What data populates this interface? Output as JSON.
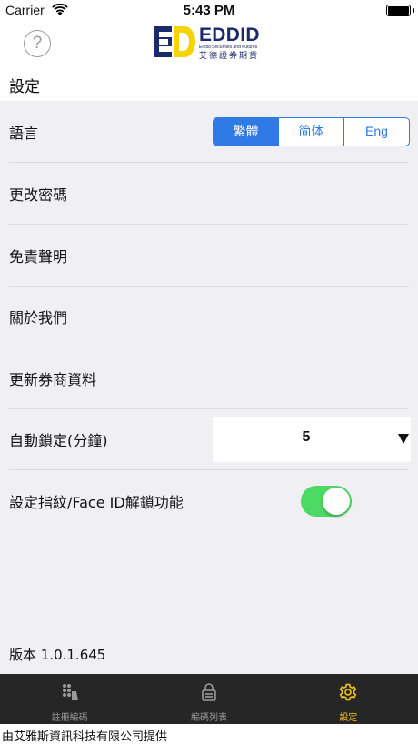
{
  "status_bar": {
    "carrier": "Carrier",
    "time": "5:43 PM",
    "wifi_icon": "wifi-icon",
    "battery_icon": "battery-icon"
  },
  "header": {
    "help_icon": "question-icon",
    "help_symbol": "?",
    "logo_title": "EDDID",
    "logo_subtitle": "Eddid Securities and Futures",
    "logo_chinese": "艾德證券期貨",
    "colors": {
      "brand_navy": "#1b2a6b",
      "brand_yellow": "#f5d400"
    }
  },
  "page": {
    "title": "設定"
  },
  "settings": {
    "language": {
      "label": "語言",
      "options": [
        "繁體",
        "简体",
        "Eng"
      ],
      "selected": "繁體"
    },
    "change_password": {
      "label": "更改密碼"
    },
    "disclaimer": {
      "label": "免責聲明"
    },
    "about": {
      "label": "關於我們"
    },
    "update_broker": {
      "label": "更新券商資料"
    },
    "auto_lock": {
      "label": "自動鎖定(分鐘)",
      "value": "5"
    },
    "biometric": {
      "label": "設定指紋/Face ID解鎖功能",
      "enabled": true
    }
  },
  "version": "版本 1.0.1.645",
  "tabs": [
    {
      "label": "註冊編碼",
      "icon": "keypad-icon",
      "active": false
    },
    {
      "label": "編碼列表",
      "icon": "lock-list-icon",
      "active": false
    },
    {
      "label": "設定",
      "icon": "gear-icon",
      "active": true
    }
  ],
  "footer": {
    "text": "由艾雅斯資訊科技有限公司提供"
  },
  "colors": {
    "accent_blue": "#2f7ae5",
    "toggle_on": "#4cd964",
    "tab_active": "#f5c518",
    "tab_bar_bg": "#262626"
  }
}
